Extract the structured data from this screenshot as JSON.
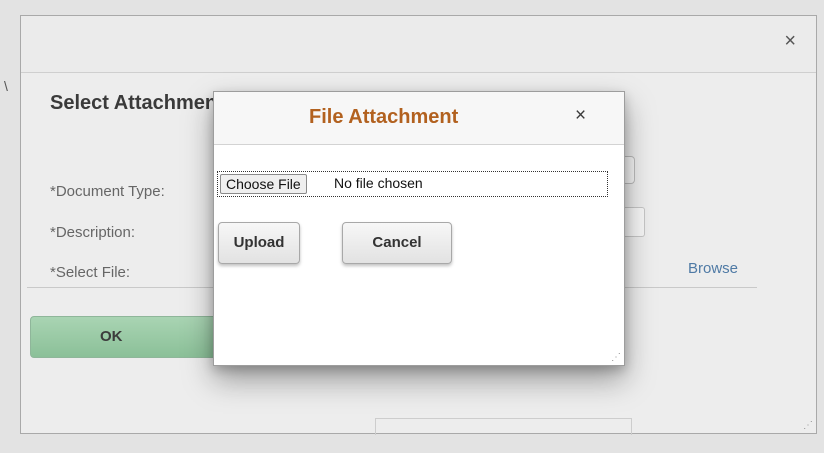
{
  "outer_dialog": {
    "close_icon": "×",
    "title": "Select Attachment",
    "labels": {
      "document_type": "*Document Type:",
      "description": "*Description:",
      "select_file": "*Select File:"
    },
    "document_type_chevron": "⌄",
    "browse_link": "Browse",
    "ok_label": "OK"
  },
  "inner_dialog": {
    "title": "File Attachment",
    "close_icon": "×",
    "choose_file_label": "Choose File",
    "no_file_text": "No file chosen",
    "upload_label": "Upload",
    "cancel_label": "Cancel"
  },
  "colors": {
    "inner_title": "#b2611f",
    "ok_button": "#8bc098",
    "browse_link": "#4f7aa5"
  },
  "icons": {
    "outer_close": "close-icon",
    "inner_close": "close-icon",
    "document_type_dropdown": "chevron-down-icon",
    "resize_handle": "resize-grip-icon"
  }
}
